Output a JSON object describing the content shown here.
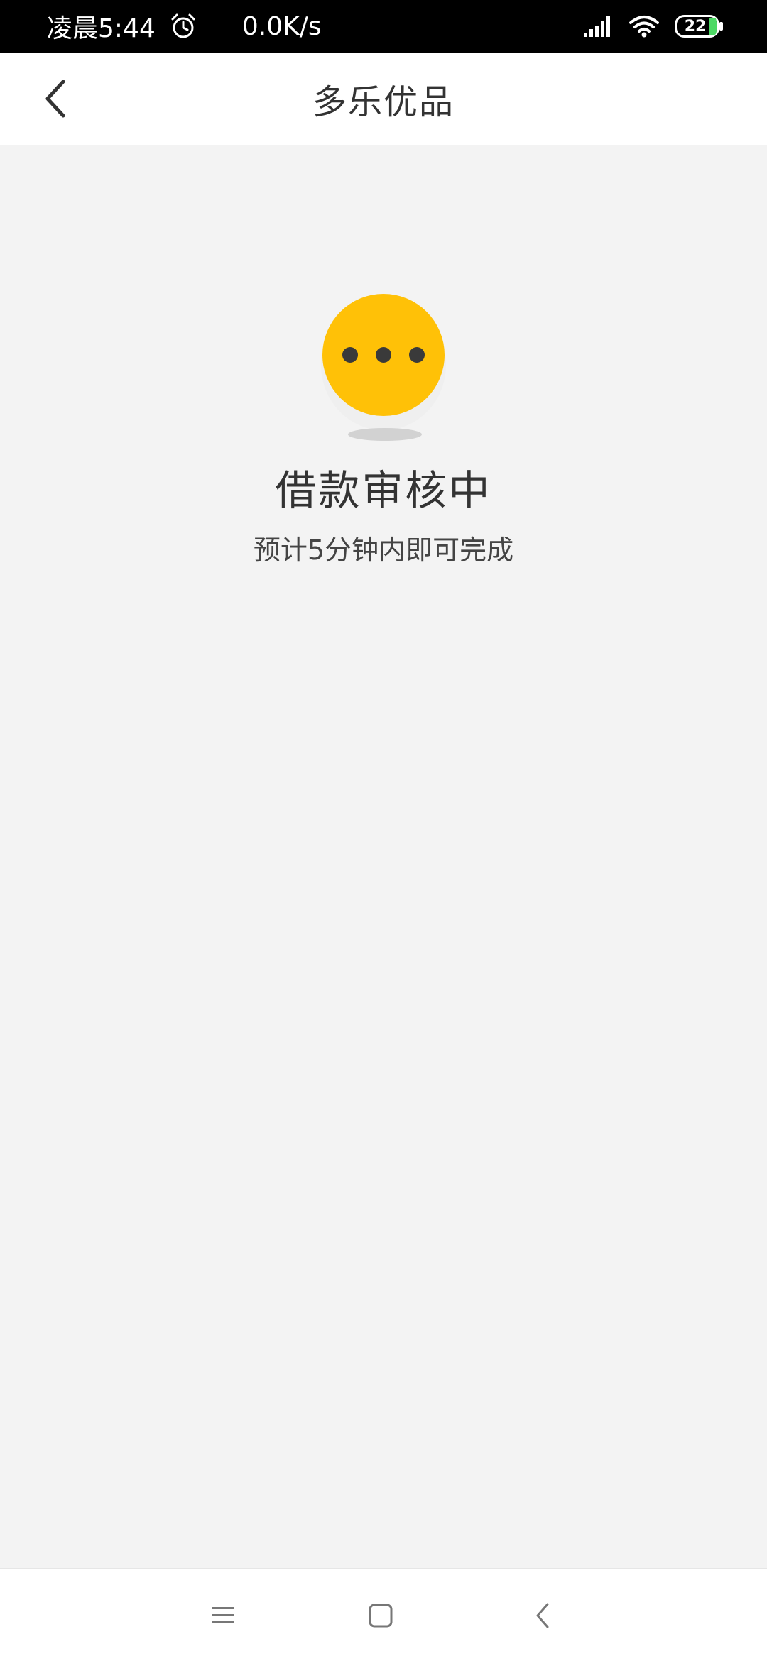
{
  "status_bar": {
    "time": "凌晨5:44",
    "net_speed": "0.0K/s",
    "battery_level": "22"
  },
  "header": {
    "title": "多乐优品"
  },
  "main": {
    "heading": "借款审核中",
    "subtext": "预计5分钟内即可完成"
  },
  "colors": {
    "accent": "#FFC107",
    "background": "#F3F3F3",
    "battery_fill": "#4CD964"
  },
  "icons": {
    "back": "back-arrow-icon",
    "status": "pending-dots-icon",
    "nav_menu": "menu-icon",
    "nav_home": "home-icon",
    "nav_back": "chevron-left-icon"
  }
}
